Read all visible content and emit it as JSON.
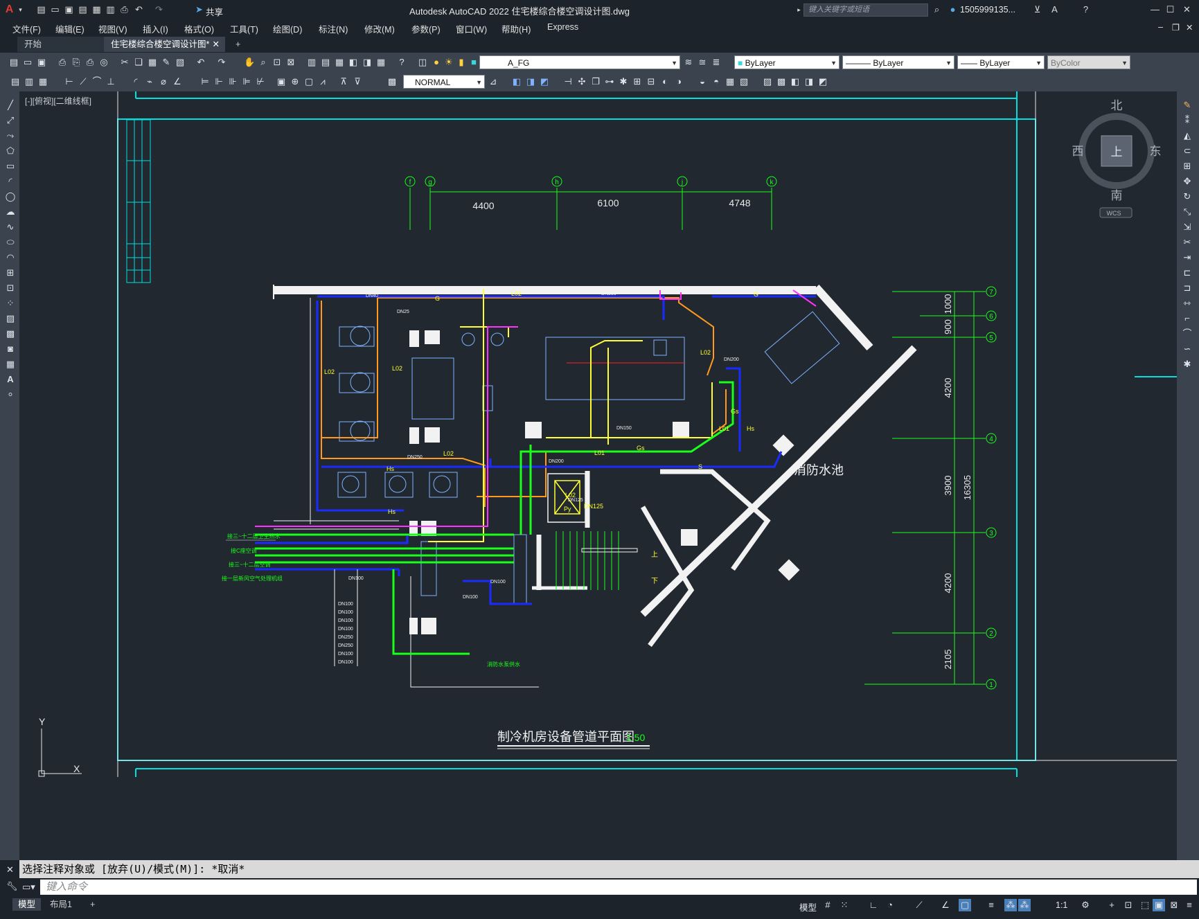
{
  "titlebar": {
    "app_title": "Autodesk AutoCAD 2022    住宅楼综合楼空调设计图.dwg",
    "share_label": "共享",
    "search_placeholder": "键入关键字或短语",
    "user_id": "1505999135...",
    "window_controls": [
      "minimize-icon",
      "restore-icon",
      "close-icon"
    ]
  },
  "menubar": {
    "items": [
      "文件(F)",
      "编辑(E)",
      "视图(V)",
      "插入(I)",
      "格式(O)",
      "工具(T)",
      "绘图(D)",
      "标注(N)",
      "修改(M)",
      "参数(P)",
      "窗口(W)",
      "帮助(H)",
      "Express"
    ]
  },
  "tabs": {
    "start": "开始",
    "active": "住宅楼综合楼空调设计图*"
  },
  "ribbon": {
    "layer": "A_FG",
    "color": "ByLayer",
    "linetype": "ByLayer",
    "lineweight": "ByLayer",
    "plotstyle": "ByColor",
    "text_style": "NORMAL"
  },
  "viewport": {
    "label": "[-][俯视][二维线框]"
  },
  "viewcube": {
    "north": "北",
    "south": "南",
    "east": "东",
    "west": "西",
    "top": "上",
    "wcs": "WCS"
  },
  "ucs": {
    "x": "X",
    "y": "Y"
  },
  "drawing": {
    "title": "制冷机房设备管道平面图",
    "scale": "1:50",
    "pool_label": "消防水池",
    "top_axes": [
      "f",
      "g",
      "h",
      "j",
      "k"
    ],
    "top_dims": [
      "4400",
      "6100",
      "4748"
    ],
    "right_axes": [
      "7",
      "6",
      "5",
      "4",
      "3",
      "2",
      "1"
    ],
    "right_dims": [
      "1000",
      "900",
      "4200",
      "3900",
      "4200",
      "2105"
    ],
    "right_total": "16305",
    "pipe_notes": [
      "接三~十二层卫生热水",
      "接C座空调",
      "接三~十二层空调",
      "接一层新风空气处理机组"
    ],
    "size_list": [
      "DN100",
      "DN100",
      "DN100",
      "DN100",
      "DN250",
      "DN250",
      "DN100",
      "DN100"
    ],
    "pipe_codes": [
      "L02",
      "G",
      "DN40",
      "DN250",
      "DN25",
      "DN200",
      "DN150",
      "DN100",
      "L01",
      "Gs",
      "Hs",
      "S",
      "DN125",
      "Py"
    ],
    "stair_up": "上",
    "stair_down": "下",
    "elevator_note": "消防水泵供水"
  },
  "command": {
    "history": "选择注释对象或 [放弃(U)/模式(M)]: *取消*",
    "placeholder": "键入命令"
  },
  "statusbar": {
    "layout_tabs": [
      "模型",
      "布局1"
    ],
    "model_label": "模型",
    "scale": "1:1"
  }
}
